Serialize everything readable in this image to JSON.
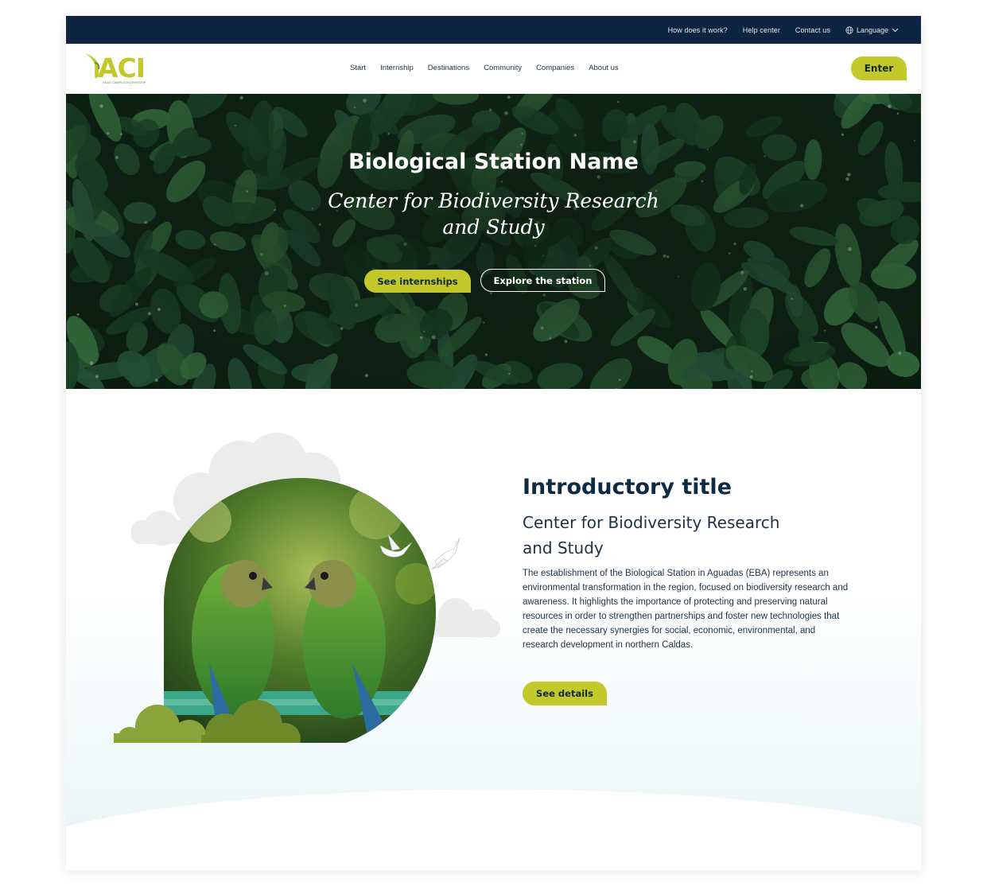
{
  "topbar": {
    "links": [
      "How does it work?",
      "Help center",
      "Contact us"
    ],
    "language_label": "Language"
  },
  "nav": {
    "logo_text": "ACI",
    "logo_tagline": "ANAS CAMPUS INTERNSHIP",
    "menu": [
      "Start",
      "Internship",
      "Destinations",
      "Community",
      "Companies",
      "About us"
    ],
    "enter_label": "Enter"
  },
  "hero": {
    "title": "Biological Station Name",
    "subtitle_line1": "Center for Biodiversity Research",
    "subtitle_line2": "and Study",
    "primary_button": "See internships",
    "secondary_button": "Explore the station"
  },
  "intro": {
    "title": "Introductory title",
    "subtitle_line1": "Center for Biodiversity Research",
    "subtitle_line2": "and Study",
    "body": "The establishment of the Biological Station in Aguadas (EBA) represents an environmental transformation in the region, focused on biodiversity research and awareness. It highlights the importance of protecting and preserving natural resources in order to strengthen partnerships and foster new technologies that create the necessary synergies for social, economic, environmental, and research development in northern Caldas.",
    "button": "See details"
  },
  "colors": {
    "navy": "#0d2540",
    "accent_green": "#c3c92b",
    "heading": "#0f2a43"
  },
  "icons": {
    "language": "globe-icon",
    "language_toggle": "chevron-down-icon"
  }
}
